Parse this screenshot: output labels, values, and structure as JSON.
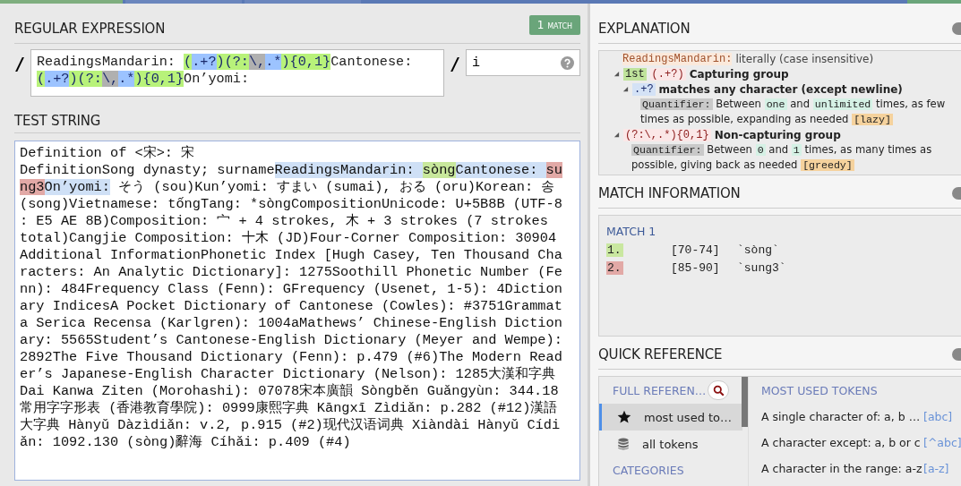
{
  "regex_panel": {
    "title": "REGULAR EXPRESSION",
    "match_badge": {
      "count": "1",
      "label": "MATCH"
    },
    "delimiter_open": "/",
    "lines": [
      [
        {
          "kind": "text",
          "text": "ReadingsMandarin: "
        },
        {
          "kind": "group",
          "text": "("
        },
        {
          "kind": "any",
          "text": ".+?"
        },
        {
          "kind": "group",
          "text": ")(?:"
        },
        {
          "kind": "escape",
          "text": "\\,"
        },
        {
          "kind": "any",
          "text": ".*"
        },
        {
          "kind": "group",
          "text": "){0,1}"
        },
        {
          "kind": "text",
          "text": "Cantonese:"
        }
      ],
      [
        {
          "kind": "group",
          "text": "("
        },
        {
          "kind": "any",
          "text": ".+?"
        },
        {
          "kind": "group",
          "text": ")(?:"
        },
        {
          "kind": "escape",
          "text": "\\,"
        },
        {
          "kind": "any",
          "text": ".*"
        },
        {
          "kind": "group",
          "text": "){0,1}"
        },
        {
          "kind": "text",
          "text": "On’yomi:"
        }
      ]
    ],
    "delimiter_close": "/",
    "flags": "i"
  },
  "test_panel": {
    "title": "TEST STRING",
    "lines": [
      [
        {
          "kind": "text",
          "text": "Definition of <宋>: 宋"
        }
      ],
      [
        {
          "kind": "text",
          "text": "DefinitionSong dynasty; surname"
        },
        {
          "kind": "match",
          "text": "ReadingsMandarin: "
        },
        {
          "kind": "group1",
          "text": "sòng"
        },
        {
          "kind": "match",
          "text": "Cantonese: "
        },
        {
          "kind": "group2",
          "text": "su"
        }
      ],
      [
        {
          "kind": "group2",
          "text": "ng3"
        },
        {
          "kind": "match",
          "text": "On’yomi:"
        },
        {
          "kind": "text",
          "text": " そう (sou)Kun’yomi: すまい (sumai), おる (oru)Korean: 송"
        }
      ],
      [
        {
          "kind": "text",
          "text": "(song)Vietnamese: tốngTang: *sòngCompositionUnicode: U+5B8B (UTF-8"
        }
      ],
      [
        {
          "kind": "text",
          "text": ": E5 AE 8B)Composition: 宀 + 4 strokes, 木 + 3 strokes (7 strokes"
        }
      ],
      [
        {
          "kind": "text",
          "text": "total)Cangjie Composition: 十木 (JD)Four-Corner Composition: 30904"
        }
      ],
      [
        {
          "kind": "text",
          "text": "Additional InformationPhonetic Index [Hugh Casey, Ten Thousand Cha"
        }
      ],
      [
        {
          "kind": "text",
          "text": "racters: An Analytic Dictionary]: 1275Soothill Phonetic Number (Fe"
        }
      ],
      [
        {
          "kind": "text",
          "text": "nn): 484Frequency Class (Fenn): GFrequency (Usenet, 1-5): 4Diction"
        }
      ],
      [
        {
          "kind": "text",
          "text": "ary IndicesA Pocket Dictionary of Cantonese (Cowles): #3751Grammat"
        }
      ],
      [
        {
          "kind": "text",
          "text": "a Serica Recensa (Karlgren): 1004aMathews’ Chinese-English Diction"
        }
      ],
      [
        {
          "kind": "text",
          "text": "ary: 5565Student’s Cantonese-English Dictionary (Meyer and Wempe):"
        }
      ],
      [
        {
          "kind": "text",
          "text": "2892The Five Thousand Dictionary (Fenn): p.479 (#6)The Modern Read"
        }
      ],
      [
        {
          "kind": "text",
          "text": "er’s Japanese-English Character Dictionary (Nelson): 1285大漢和字典"
        }
      ],
      [
        {
          "kind": "text",
          "text": "Dai Kanwa Ziten (Morohashi): 07078宋本廣韻 Sòngběn Guǎngyùn: 344.18"
        }
      ],
      [
        {
          "kind": "text",
          "text": "常用字字形表 (香港教育學院): 0999康熙字典 Kāngxī Zìdiǎn: p.282 (#12)漢語"
        }
      ],
      [
        {
          "kind": "text",
          "text": "大字典 Hànyǔ Dàzìdiǎn: v.2, p.915 (#2)现代汉语词典 Xiàndài Hànyǔ Cídi"
        }
      ],
      [
        {
          "kind": "text",
          "text": "ǎn: 1092.130 (sòng)辭海 Cíhǎi: p.409 (#4)"
        }
      ]
    ]
  },
  "explanation": {
    "title": "EXPLANATION",
    "items": [
      {
        "kind": "literal",
        "token": "ReadingsMandarin: ",
        "text": "literally (case insensitive)"
      },
      {
        "kind": "group",
        "expanded": true,
        "badge": "1st",
        "title": "Capturing group",
        "token": "(.+?)",
        "children": [
          {
            "kind": "token",
            "expanded": true,
            "token": ".+?",
            "title": "matches any character (except newline)",
            "quantifier": {
              "label": "Quantifier:",
              "parts": [
                {
                  "kind": "text",
                  "text": "Between "
                },
                {
                  "kind": "value",
                  "text": "one"
                },
                {
                  "kind": "text",
                  "text": " and "
                },
                {
                  "kind": "value",
                  "text": "unlimited"
                },
                {
                  "kind": "text",
                  "text": " times, as few times as possible, expanding as needed "
                },
                {
                  "kind": "mode",
                  "text": "[lazy]"
                }
              ]
            }
          }
        ]
      },
      {
        "kind": "group",
        "expanded": true,
        "token": "(?:\\,.*){0,1}",
        "title": "Non-capturing group",
        "quantifier": {
          "label": "Quantifier:",
          "parts": [
            {
              "kind": "text",
              "text": "Between "
            },
            {
              "kind": "value",
              "text": "0"
            },
            {
              "kind": "text",
              "text": " and "
            },
            {
              "kind": "value",
              "text": "1"
            },
            {
              "kind": "text",
              "text": " times, as many times as possible, giving back as needed "
            },
            {
              "kind": "mode",
              "text": "[greedy]"
            }
          ]
        }
      }
    ]
  },
  "match_info": {
    "title": "MATCH INFORMATION",
    "match_label": "MATCH 1",
    "groups": [
      {
        "number": "1.",
        "range": "[70-74]",
        "value": "`sòng`",
        "color": "#c9e7a0"
      },
      {
        "number": "2.",
        "range": "[85-90]",
        "value": "`sung3`",
        "color": "#e2a9a6"
      }
    ]
  },
  "quick_reference": {
    "title": "QUICK REFERENCE",
    "sidebar_title": "FULL REFEREN…",
    "items": [
      {
        "label": "most used to…",
        "selected": true
      },
      {
        "label": "all tokens",
        "selected": false
      }
    ],
    "categories_label": "CATEGORIES",
    "tokens_title": "MOST USED TOKENS",
    "tokens": [
      {
        "description": "A single character of: a, b …",
        "pattern": "[abc]"
      },
      {
        "description": "A character except: a, b or c",
        "pattern": "[^abc]"
      },
      {
        "description": "A character in the range: a-z",
        "pattern": "[a-z]"
      }
    ]
  }
}
